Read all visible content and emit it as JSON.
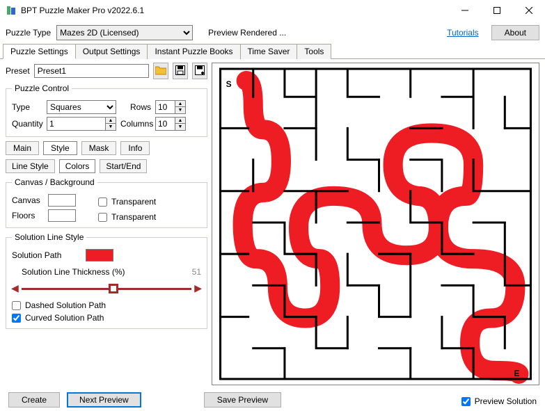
{
  "window": {
    "title": "BPT Puzzle Maker Pro v2022.6.1"
  },
  "top": {
    "puzzle_type_label": "Puzzle Type",
    "puzzle_type_value": "Mazes 2D (Licensed)",
    "status": "Preview Rendered ...",
    "tutorials": "Tutorials",
    "about": "About"
  },
  "main_tabs": [
    "Puzzle Settings",
    "Output Settings",
    "Instant Puzzle Books",
    "Time Saver",
    "Tools"
  ],
  "active_main_tab": 0,
  "preset": {
    "label": "Preset",
    "value": "Preset1"
  },
  "puzzle_control": {
    "legend": "Puzzle Control",
    "type_label": "Type",
    "type_value": "Squares",
    "rows_label": "Rows",
    "rows_value": "10",
    "quantity_label": "Quantity",
    "quantity_value": "1",
    "columns_label": "Columns",
    "columns_value": "10"
  },
  "style_tabs": [
    "Main",
    "Style",
    "Mask",
    "Info"
  ],
  "active_style_tab": 1,
  "style_subtabs": [
    "Line Style",
    "Colors",
    "Start/End"
  ],
  "active_style_subtab": 1,
  "canvas_bg": {
    "legend": "Canvas / Background",
    "canvas_label": "Canvas",
    "transparent1": "Transparent",
    "floors_label": "Floors",
    "transparent2": "Transparent"
  },
  "solution_style": {
    "legend": "Solution Line Style",
    "path_label": "Solution Path",
    "thickness_label": "Solution Line Thickness (%)",
    "thickness_value": "51",
    "dashed_label": "Dashed Solution Path",
    "curved_label": "Curved Solution Path",
    "dashed_checked": false,
    "curved_checked": true,
    "color": "#ee1c23"
  },
  "bottom": {
    "create": "Create",
    "next_preview": "Next Preview",
    "save_preview": "Save Preview",
    "preview_solution": "Preview Solution",
    "preview_solution_checked": true
  },
  "maze": {
    "start_label": "S",
    "end_label": "E"
  }
}
